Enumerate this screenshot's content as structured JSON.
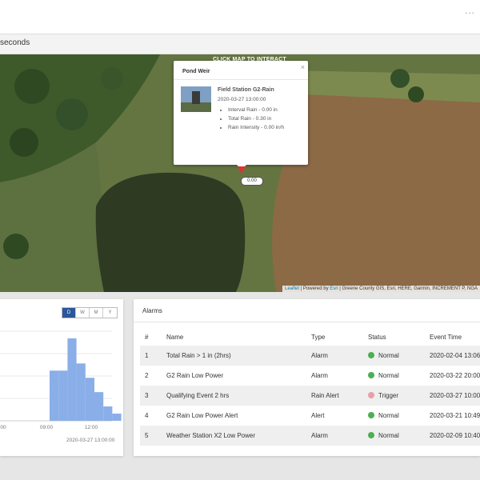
{
  "header": {
    "menu_dots": "..."
  },
  "refresh_bar": {
    "text": "seconds"
  },
  "map": {
    "click_hint": "CLICK MAP TO INTERACT",
    "attribution": {
      "leaflet": "Leaflet",
      "sep": " | Powered by ",
      "esri": "Esri",
      "rest": " | Greene County GIS, Esri, HERE, Garmin, INCREMENT P, NGA"
    },
    "marker_value": "0.00",
    "popup": {
      "title": "Pond Weir",
      "close": "×",
      "station": "Field Station G2-Rain",
      "timestamp": "2020-03-27 13:00:00",
      "readings": [
        "Interval Rain - 0.00 in",
        "Total Rain - 0.30 in",
        "Rain Intensity - 0.00 in/h"
      ]
    }
  },
  "chart_card": {
    "periods": [
      "D",
      "W",
      "M",
      "Y"
    ],
    "active_period": "D",
    "footer": "2020-03-27 13:00:00"
  },
  "chart_data": {
    "type": "bar",
    "x": [
      "09:00",
      "09:30",
      "10:00",
      "10:30",
      "11:00",
      "11:30",
      "12:00",
      "12:30"
    ],
    "values": [
      0.14,
      0.14,
      0.23,
      0.16,
      0.12,
      0.08,
      0.04,
      0.02
    ],
    "xticks": [
      "00",
      "09:00",
      "12:00"
    ],
    "colors": {
      "bar": "#8aaee8"
    }
  },
  "alarms": {
    "title": "Alarms",
    "columns": [
      "#",
      "Name",
      "Type",
      "Status",
      "Event Time"
    ],
    "rows": [
      {
        "num": "1",
        "name": "Total Rain > 1 in (2hrs)",
        "type": "Alarm",
        "status": "Normal",
        "status_color": "#4caf50",
        "time": "2020-02-04 13:06"
      },
      {
        "num": "2",
        "name": "G2 Rain Low Power",
        "type": "Alarm",
        "status": "Normal",
        "status_color": "#4caf50",
        "time": "2020-03-22 20:00"
      },
      {
        "num": "3",
        "name": "Qualifying Event 2 hrs",
        "type": "Rain Alert",
        "status": "Trigger",
        "status_color": "#e8a0a8",
        "time": "2020-03-27 10:00"
      },
      {
        "num": "4",
        "name": "G2 Rain Low Power Alert",
        "type": "Alert",
        "status": "Normal",
        "status_color": "#4caf50",
        "time": "2020-03-21 10:49"
      },
      {
        "num": "5",
        "name": "Weather Station X2 Low Power",
        "type": "Alarm",
        "status": "Normal",
        "status_color": "#4caf50",
        "time": "2020-02-09 10:40"
      }
    ]
  }
}
